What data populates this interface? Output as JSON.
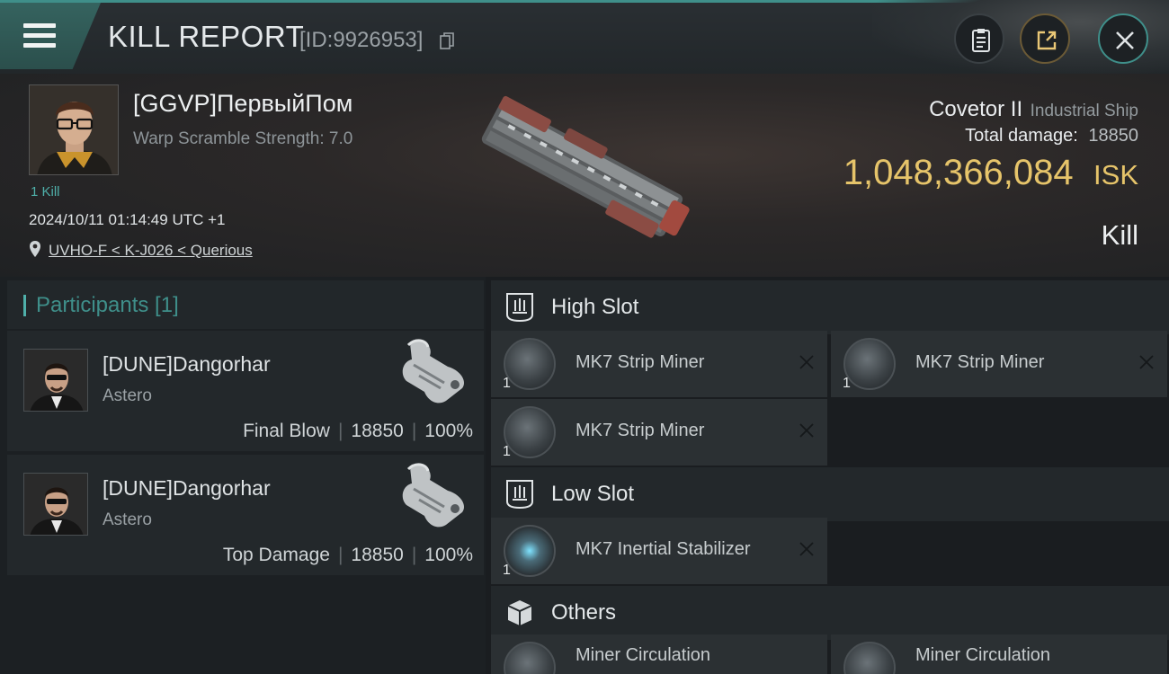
{
  "header": {
    "title": "KILL REPORT",
    "report_id": "[ID:9926953]",
    "icons": [
      "menu-icon",
      "copy-icon",
      "clipboard-icon",
      "share-icon",
      "close-icon"
    ]
  },
  "victim": {
    "pilot_name": "[GGVP]ПервыйПом",
    "scramble_text": "Warp Scramble Strength: 7.0",
    "kills_tag": "1 Kill",
    "timestamp": "2024/10/11 01:14:49 UTC +1",
    "location": "UVHO-F < K-J026 < Querious",
    "ship_name": "Covetor II",
    "ship_class": "Industrial Ship",
    "total_damage_label": "Total damage:",
    "total_damage_value": "18850",
    "isk_value": "1,048,366,084",
    "isk_currency": "ISK",
    "result": "Kill"
  },
  "participants": {
    "title": "Participants [1]",
    "rows": [
      {
        "name": "[DUNE]Dangorhar",
        "ship": "Astero",
        "role": "Final Blow",
        "damage": "18850",
        "percent": "100%"
      },
      {
        "name": "[DUNE]Dangorhar",
        "ship": "Astero",
        "role": "Top Damage",
        "damage": "18850",
        "percent": "100%"
      }
    ]
  },
  "fitting": {
    "high_slot": {
      "title": "High Slot",
      "modules": [
        {
          "name": "MK7 Strip Miner",
          "qty": "1"
        },
        {
          "name": "MK7 Strip Miner",
          "qty": "1"
        },
        {
          "name": "MK7 Strip Miner",
          "qty": "1"
        }
      ]
    },
    "low_slot": {
      "title": "Low Slot",
      "modules": [
        {
          "name": "MK7 Inertial Stabilizer",
          "qty": "1"
        }
      ]
    },
    "others": {
      "title": "Others",
      "modules": [
        {
          "name": "Miner Circulation"
        },
        {
          "name": "Miner Circulation"
        }
      ]
    }
  },
  "colors": {
    "accent_teal": "#3f8f8a",
    "isk_gold": "#e6c46a",
    "background": "#15181b"
  }
}
